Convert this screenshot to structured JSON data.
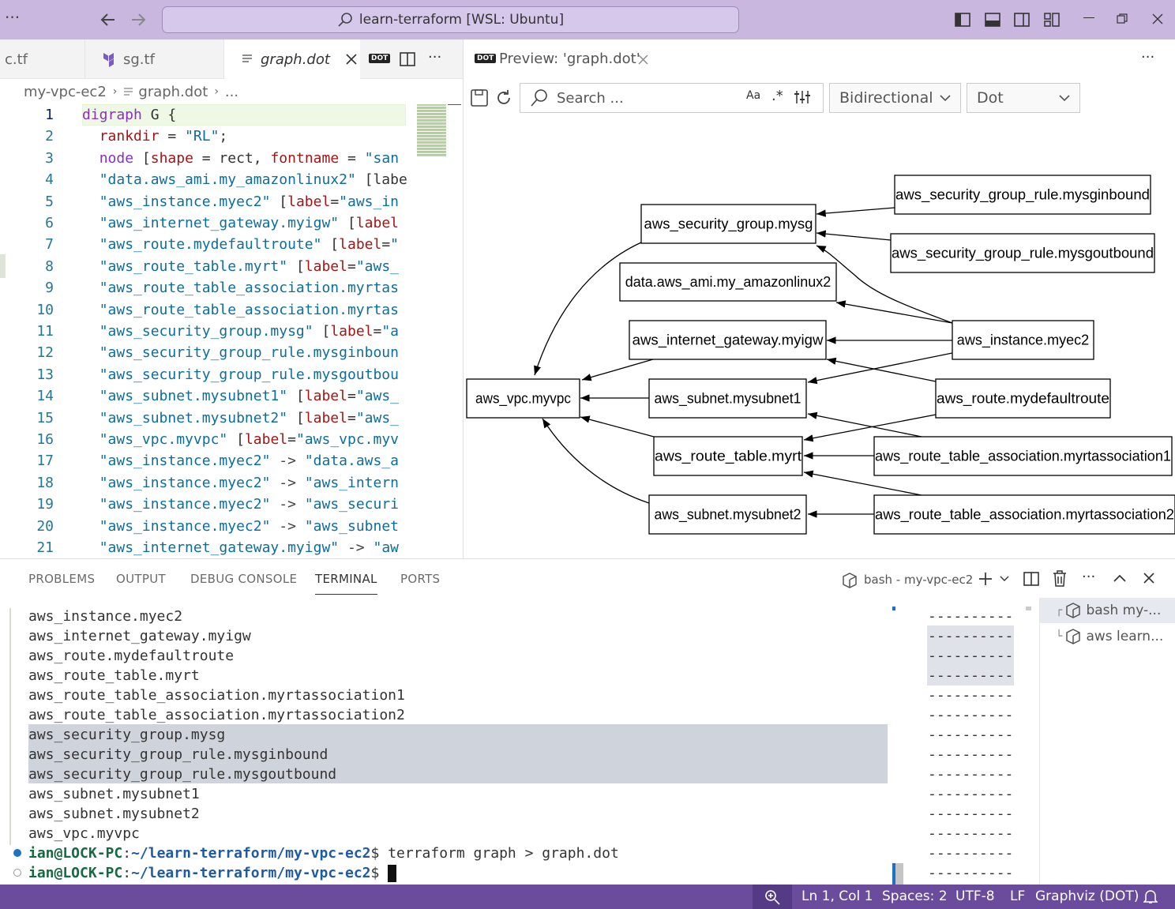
{
  "titlebar": {
    "menu_icon": "ellipsis-icon",
    "back_icon": "arrow-left-icon",
    "forward_icon": "arrow-right-icon",
    "command_center": "learn-terraform [WSL: Ubuntu]",
    "layout_icons": [
      "toggle-primary-sidebar-icon",
      "toggle-panel-icon",
      "toggle-secondary-sidebar-icon",
      "customize-layout-icon"
    ],
    "window_controls": [
      "minimize-icon",
      "restore-icon",
      "close-icon"
    ]
  },
  "editor_tabs": [
    {
      "label": "c.tf",
      "icon": "",
      "active": false
    },
    {
      "label": "sg.tf",
      "icon": "terraform-icon",
      "active": false
    },
    {
      "label": "graph.dot",
      "icon": "file-lines-icon",
      "active": true
    }
  ],
  "editor_actions": {
    "badge": "DOT",
    "split_icon": "split-editor-icon",
    "more_icon": "ellipsis-icon"
  },
  "breadcrumb": {
    "folder": "my-vpc-ec2",
    "file": "graph.dot",
    "more": "..."
  },
  "code_lines": [
    {
      "n": "1",
      "t": "digraph G {"
    },
    {
      "n": "2",
      "t": "  rankdir = \"RL\";"
    },
    {
      "n": "3",
      "t": "  node [shape = rect, fontname = \"san"
    },
    {
      "n": "4",
      "t": "  \"data.aws_ami.my_amazonlinux2\" [labe"
    },
    {
      "n": "5",
      "t": "  \"aws_instance.myec2\" [label=\"aws_in"
    },
    {
      "n": "6",
      "t": "  \"aws_internet_gateway.myigw\" [label"
    },
    {
      "n": "7",
      "t": "  \"aws_route.mydefaultroute\" [label=\""
    },
    {
      "n": "8",
      "t": "  \"aws_route_table.myrt\" [label=\"aws_"
    },
    {
      "n": "9",
      "t": "  \"aws_route_table_association.myrtas"
    },
    {
      "n": "10",
      "t": "  \"aws_route_table_association.myrtas"
    },
    {
      "n": "11",
      "t": "  \"aws_security_group.mysg\" [label=\"a"
    },
    {
      "n": "12",
      "t": "  \"aws_security_group_rule.mysginboun"
    },
    {
      "n": "13",
      "t": "  \"aws_security_group_rule.mysgoutbou"
    },
    {
      "n": "14",
      "t": "  \"aws_subnet.mysubnet1\" [label=\"aws_"
    },
    {
      "n": "15",
      "t": "  \"aws_subnet.mysubnet2\" [label=\"aws_"
    },
    {
      "n": "16",
      "t": "  \"aws_vpc.myvpc\" [label=\"aws_vpc.myv"
    },
    {
      "n": "17",
      "t": "  \"aws_instance.myec2\" -> \"data.aws_a"
    },
    {
      "n": "18",
      "t": "  \"aws_instance.myec2\" -> \"aws_intern"
    },
    {
      "n": "19",
      "t": "  \"aws_instance.myec2\" -> \"aws_securi"
    },
    {
      "n": "20",
      "t": "  \"aws_instance.myec2\" -> \"aws_subnet"
    },
    {
      "n": "21",
      "t": "  \"aws_internet_gateway.myigw\" -> \"aw"
    }
  ],
  "preview": {
    "tab_badge": "DOT",
    "tab_label": "Preview: 'graph.dot'",
    "more_icon": "ellipsis-icon",
    "save_icon": "save-icon",
    "refresh_icon": "refresh-icon",
    "search_placeholder": "Search ...",
    "search_icon": "search-icon",
    "match_case": "Aa",
    "regex_icon": "regex-icon",
    "filter_icon": "filter-settings-icon",
    "direction": "Bidirectional",
    "engine": "Dot"
  },
  "graph": {
    "nodes": [
      {
        "id": "sgin",
        "label": "aws_security_group_rule.mysginbound"
      },
      {
        "id": "sg",
        "label": "aws_security_group.mysg"
      },
      {
        "id": "sgout",
        "label": "aws_security_group_rule.mysgoutbound"
      },
      {
        "id": "ami",
        "label": "data.aws_ami.my_amazonlinux2"
      },
      {
        "id": "igw",
        "label": "aws_internet_gateway.myigw"
      },
      {
        "id": "ec2",
        "label": "aws_instance.myec2"
      },
      {
        "id": "vpc",
        "label": "aws_vpc.myvpc"
      },
      {
        "id": "sn1",
        "label": "aws_subnet.mysubnet1"
      },
      {
        "id": "route",
        "label": "aws_route.mydefaultroute"
      },
      {
        "id": "rt",
        "label": "aws_route_table.myrt"
      },
      {
        "id": "rta1",
        "label": "aws_route_table_association.myrtassociation1"
      },
      {
        "id": "sn2",
        "label": "aws_subnet.mysubnet2"
      },
      {
        "id": "rta2",
        "label": "aws_route_table_association.myrtassociation2"
      }
    ],
    "edges": [
      [
        "sgin",
        "sg"
      ],
      [
        "sgout",
        "sg"
      ],
      [
        "ec2",
        "sg"
      ],
      [
        "ec2",
        "ami"
      ],
      [
        "ec2",
        "igw"
      ],
      [
        "ec2",
        "sn1"
      ],
      [
        "route",
        "igw"
      ],
      [
        "route",
        "rt"
      ],
      [
        "igw",
        "vpc"
      ],
      [
        "sg",
        "vpc"
      ],
      [
        "sn1",
        "vpc"
      ],
      [
        "rt",
        "vpc"
      ],
      [
        "sn2",
        "vpc"
      ],
      [
        "rta1",
        "rt"
      ],
      [
        "rta1",
        "sn1"
      ],
      [
        "rta2",
        "rt"
      ],
      [
        "rta2",
        "sn2"
      ]
    ]
  },
  "panel": {
    "tabs": [
      "PROBLEMS",
      "OUTPUT",
      "DEBUG CONSOLE",
      "TERMINAL",
      "PORTS"
    ],
    "active_tab": "TERMINAL",
    "terminal_name": "bash - my-vpc-ec2",
    "actions": [
      "plus-icon",
      "chevron-down-icon",
      "split-terminal-icon",
      "trash-icon",
      "ellipsis-icon",
      "chevron-up-icon",
      "close-icon"
    ]
  },
  "terminal": {
    "lines": [
      "aws_instance.myec2",
      "aws_internet_gateway.myigw",
      "aws_route.mydefaultroute",
      "aws_route_table.myrt",
      "aws_route_table_association.myrtassociation1",
      "aws_route_table_association.myrtassociation2",
      "aws_security_group.mysg",
      "aws_security_group_rule.mysginbound",
      "aws_security_group_rule.mysgoutbound",
      "aws_subnet.mysubnet1",
      "aws_subnet.mysubnet2",
      "aws_vpc.myvpc"
    ],
    "prompt_user": "ian@LOCK-PC",
    "prompt_path": "~/learn-terraform/my-vpc-ec2",
    "prompt_end": "$",
    "command": "terraform graph > graph.dot",
    "dash_line": "----------"
  },
  "terminal_list": [
    {
      "label": "bash  my-...",
      "icon": "terminal-cube-icon"
    },
    {
      "label": "aws  learn...",
      "icon": "terminal-cube-icon"
    }
  ],
  "statusbar": {
    "zoom_icon": "zoom-icon",
    "position": "Ln 1, Col 1",
    "spaces": "Spaces: 2",
    "encoding": "UTF-8",
    "eol": "LF",
    "language": "Graphviz (DOT)",
    "bell_icon": "bell-icon"
  }
}
